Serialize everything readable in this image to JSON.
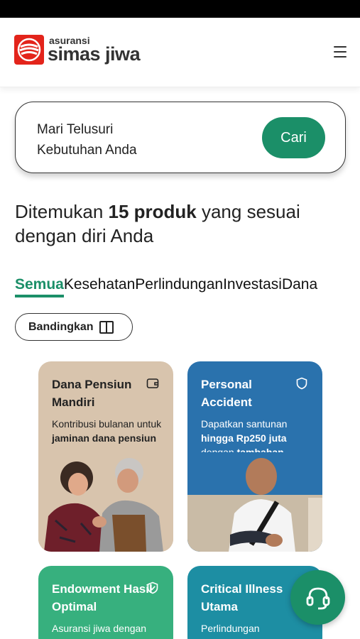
{
  "brand": {
    "small": "asuransi",
    "big": "simas jiwa",
    "color": "#e3241b"
  },
  "header": {
    "menu_icon": "hamburger-menu-icon"
  },
  "search": {
    "line1": "Mari Telusuri",
    "line2": "Kebutuhan Anda",
    "button": "Cari"
  },
  "result": {
    "prefix": "Ditemukan ",
    "count": "15 produk",
    "suffix": " yang sesuai dengan diri Anda"
  },
  "tabs": [
    {
      "label": "Semua",
      "active": true
    },
    {
      "label": "Kesehatan"
    },
    {
      "label": "Perlindungan"
    },
    {
      "label": "Investasi"
    },
    {
      "label": "Dana"
    }
  ],
  "compare": {
    "label": "Bandingkan",
    "icon": "compare-columns-icon"
  },
  "products": [
    {
      "title": "Dana Pensiun Mandiri",
      "icon": "wallet-icon",
      "desc_1": "Kontribusi bulanan untuk ",
      "desc_2": "jaminan dana pensiun",
      "desc_3": "",
      "desc_4": ""
    },
    {
      "title": "Personal Accident",
      "icon": "shield-icon",
      "desc_1": "Dapatkan santunan ",
      "desc_2": "hingga Rp250 juta",
      "desc_3": " dengan ",
      "desc_4": "tambahan manfaat"
    },
    {
      "title": "Endowment Hasil Optimal",
      "icon": "shield-check-icon",
      "desc_1": "Asuransi jiwa dengan"
    },
    {
      "title": "Critical Illness Utama",
      "icon": "heart-icon",
      "desc_1": "Perlindungan"
    }
  ],
  "colors": {
    "accent": "#1b8f68",
    "card1": "#d8c4ad",
    "card2": "#2a72ad",
    "card3": "#37b07e",
    "card4": "#1d8ea3"
  },
  "fab": {
    "icon": "headset-support-icon"
  }
}
